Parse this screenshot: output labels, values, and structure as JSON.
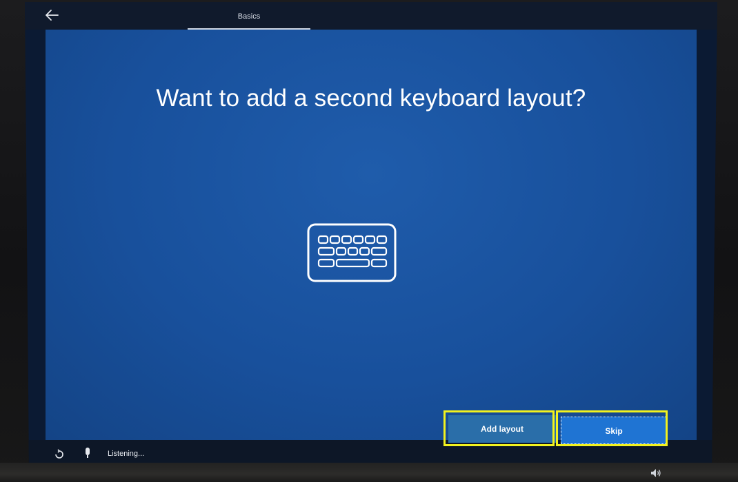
{
  "topbar": {
    "back_icon": "back-arrow-icon",
    "tab_label": "Basics"
  },
  "main": {
    "title": "Want to add a second keyboard layout?",
    "hero_icon": "keyboard-icon"
  },
  "actions": {
    "add_layout_label": "Add layout",
    "skip_label": "Skip"
  },
  "status_bar": {
    "ease_of_access_icon": "ease-of-access-icon",
    "microphone_icon": "microphone-icon",
    "listening_text": "Listening...",
    "volume_icon": "volume-icon"
  },
  "colors": {
    "background_blue": "#18509c",
    "button_blue": "#1f74d3",
    "highlight_yellow": "#f2f21e"
  }
}
